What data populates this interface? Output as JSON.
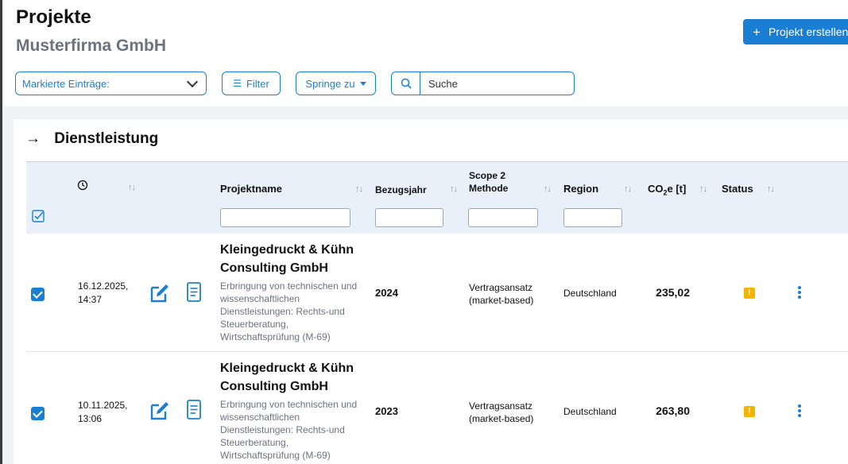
{
  "header": {
    "title": "Projekte",
    "subtitle": "Musterfirma GmbH",
    "create_button": "Projekt erstellen"
  },
  "toolbar": {
    "marked_entries": "Markierte Einträge:",
    "filter": "Filter",
    "jump_to": "Springe zu",
    "search_placeholder": "Suche"
  },
  "section": {
    "title": "Dienstleistung"
  },
  "table": {
    "columns": {
      "name": "Projektname",
      "year": "Bezugsjahr",
      "scope_line1": "Scope 2",
      "scope_line2": "Methode",
      "region": "Region",
      "co2_prefix": "CO",
      "co2_sub": "2",
      "co2_suffix": "e [t]",
      "status": "Status"
    },
    "rows": [
      {
        "date": "16.12.2025,",
        "time": "14:37",
        "name": "Kleingedruckt & Kühn Consulting GmbH",
        "description": "Erbringung von technischen und wissenschaftlichen Dienstleistungen: Rechts-und Steuerberatung, Wirtschaftsprüfung (M-69)",
        "year": "2024",
        "method": "Vertragsansatz (market-based)",
        "region": "Deutschland",
        "co2": "235,02",
        "status": "!"
      },
      {
        "date": "10.11.2025,",
        "time": "13:06",
        "name": "Kleingedruckt & Kühn Consulting GmbH",
        "description": "Erbringung von technischen und wissenschaftlichen Dienstleistungen: Rechts-und Steuerberatung, Wirtschaftsprüfung (M-69)",
        "year": "2023",
        "method": "Vertragsansatz (market-based)",
        "region": "Deutschland",
        "co2": "263,80",
        "status": "!"
      }
    ]
  },
  "colors": {
    "accent": "#1a7fd4",
    "warning": "#f4b500",
    "header_bg": "#e8f1fa"
  },
  "icons": [
    "plus-icon",
    "chevron-down-icon",
    "filter-icon",
    "caret-down-icon",
    "search-icon",
    "arrow-right-icon",
    "clock-icon",
    "sort-icon",
    "select-all-icon",
    "edit-icon",
    "document-icon",
    "kebab-menu-icon"
  ]
}
